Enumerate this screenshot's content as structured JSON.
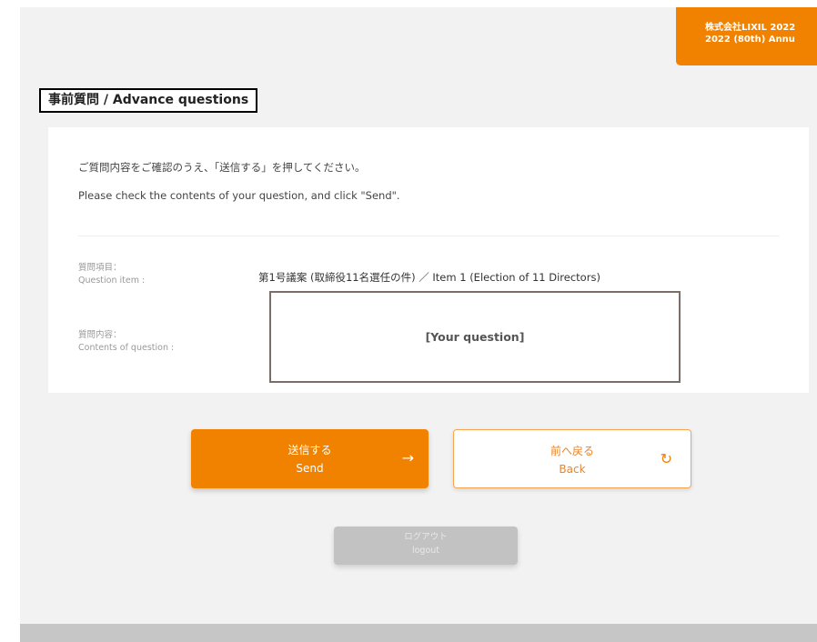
{
  "header": {
    "badge_line1": "株式会社LIXIL 2022",
    "badge_line2": "2022 (80th) Annu"
  },
  "page": {
    "title": "事前質問 / Advance questions"
  },
  "card": {
    "instruction_jp": "ご質問内容をご確認のうえ、「送信する」を押してください。",
    "instruction_en": "Please check the contents of your question, and click \"Send\".",
    "question_item_label_jp": "質問項目：",
    "question_item_label_en": "Question item :",
    "question_item_value": "第1号議案 (取締役11名選任の件) ／ Item 1 (Election of 11 Directors)",
    "contents_label_jp": "質問内容：",
    "contents_label_en": "Contents of question :",
    "question_text": "[Your question]"
  },
  "buttons": {
    "send_jp": "送信する",
    "send_en": "Send",
    "send_icon": "arrow-right",
    "back_jp": "前へ戻る",
    "back_en": "Back",
    "back_icon": "reload",
    "logout_jp": "ログアウト",
    "logout_en": "logout"
  },
  "colors": {
    "accent": "#f08200",
    "background": "#f2f2f2",
    "logout": "#c2c2c2"
  }
}
